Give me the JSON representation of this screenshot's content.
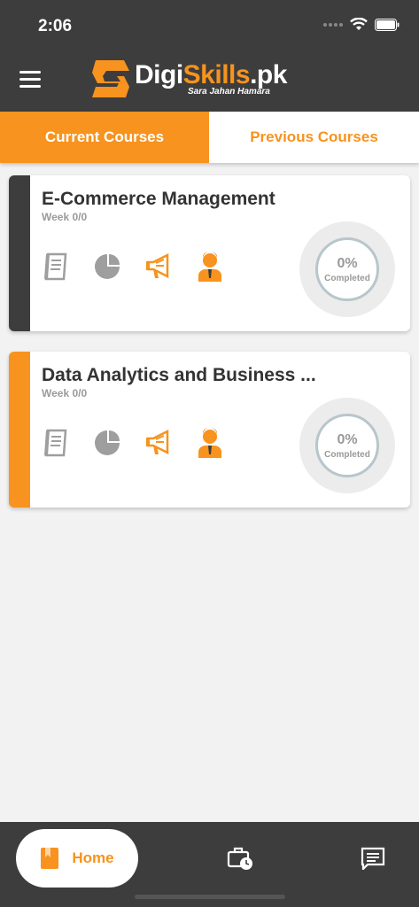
{
  "status_bar": {
    "time": "2:06"
  },
  "header": {
    "logo": {
      "digi": "Digi",
      "skills": "Skills",
      "pk": ".pk",
      "tagline": "Sara Jahan Hamara"
    },
    "menu_icon": "hamburger-icon"
  },
  "tabs": [
    {
      "label": "Current Courses",
      "active": true
    },
    {
      "label": "Previous Courses",
      "active": false
    }
  ],
  "courses": [
    {
      "title": "E-Commerce Management",
      "week": "Week 0/0",
      "progress_pct": "0%",
      "progress_label": "Completed",
      "accent": "#3d3d3d"
    },
    {
      "title": "Data Analytics and Business ...",
      "week": "Week 0/0",
      "progress_pct": "0%",
      "progress_label": "Completed",
      "accent": "#f7931e"
    }
  ],
  "bottom_nav": {
    "home_label": "Home",
    "items": [
      "home-icon",
      "briefcase-clock-icon",
      "chat-icon"
    ]
  },
  "colors": {
    "accent": "#f7931e",
    "dark": "#3d3d3d",
    "icon_gray": "#9e9e9e"
  }
}
